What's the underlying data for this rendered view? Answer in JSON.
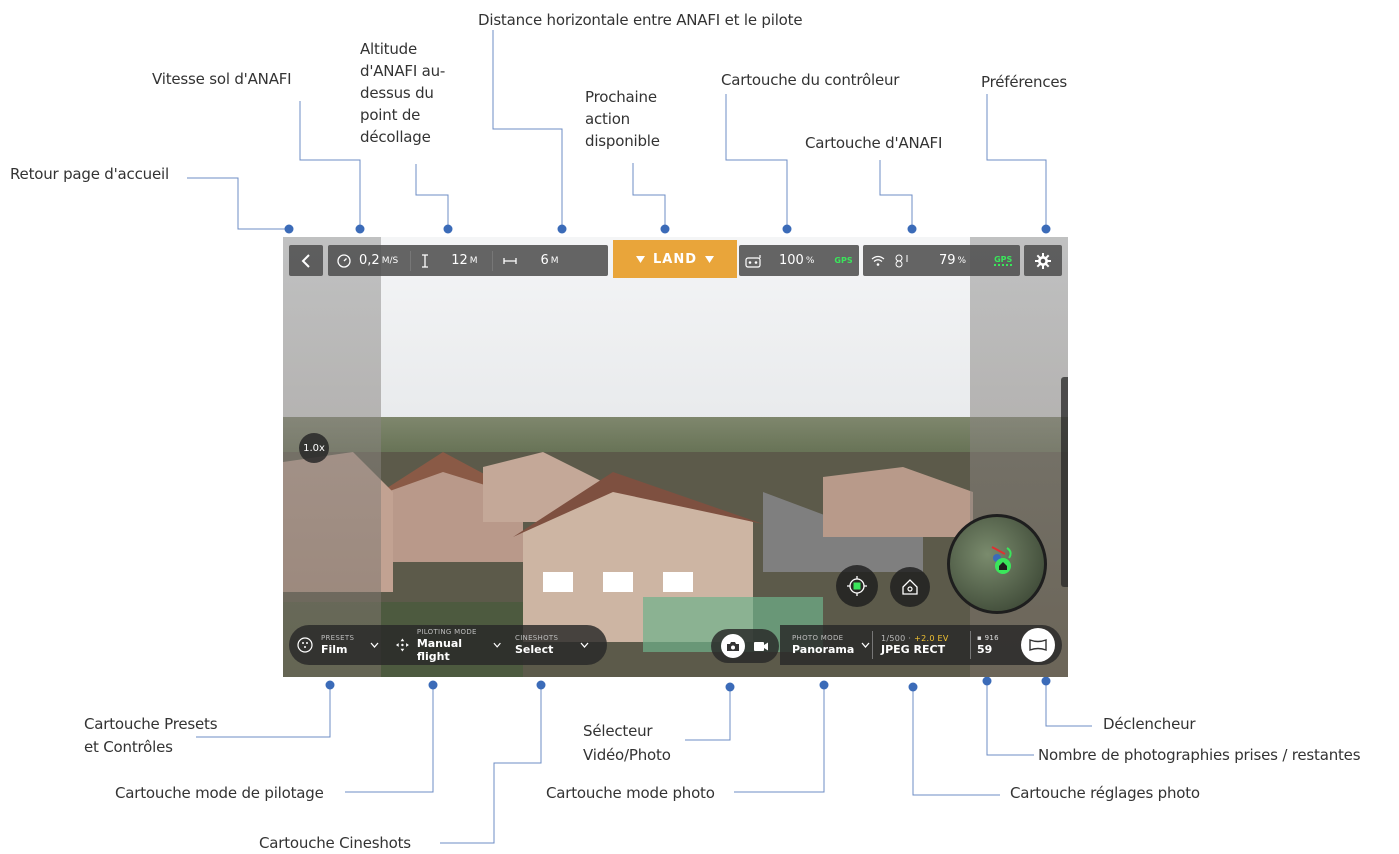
{
  "annotations": {
    "retour": "Retour page d'accueil",
    "vitesse": "Vitesse sol d'ANAFI",
    "altitude": "Altitude d'ANAFI au-dessus du point de décollage",
    "distance": "Distance horizontale entre ANAFI et le pilote",
    "prochaine": "Prochaine action disponible",
    "cartouche_controleur": "Cartouche du contrôleur",
    "cartouche_anafi": "Cartouche d'ANAFI",
    "preferences": "Préférences",
    "presets_line1": "Cartouche Presets",
    "presets_line2": "et Contrôles",
    "mode_pilotage": "Cartouche mode de pilotage",
    "cineshots": "Cartouche Cineshots",
    "selecteur_line1": "Sélecteur",
    "selecteur_line2": "Vidéo/Photo",
    "mode_photo": "Cartouche mode photo",
    "reglages_photo": "Cartouche réglages photo",
    "nombre_photos": "Nombre de photographies prises / restantes",
    "declencheur": "Déclencheur"
  },
  "hud": {
    "speed_value": "0,2",
    "speed_unit": "M/S",
    "altitude_value": "12",
    "altitude_unit": "M",
    "distance_value": "6",
    "distance_unit": "M",
    "land_label": "LAND",
    "controller_battery": "100",
    "controller_battery_unit": "%",
    "controller_gps": "GPS",
    "drone_battery": "79",
    "drone_battery_unit": "%",
    "drone_gps": "GPS",
    "zoom": "1.0x"
  },
  "bottom": {
    "presets_caption": "PRESETS",
    "presets_value": "Film",
    "piloting_caption": "PILOTING MODE",
    "piloting_value": "Manual flight",
    "cineshots_caption": "CINESHOTS",
    "cineshots_value": "Select",
    "photo_mode_caption": "PHOTO MODE",
    "photo_mode_value": "Panorama",
    "shutter_speed": "1/500",
    "separator": "·",
    "ev": "+2.0 EV",
    "format": "JPEG RECT",
    "photos_remaining": "916",
    "photos_taken": "59"
  },
  "colors": {
    "land_bg": "#e9a53a",
    "gps_green": "#3ae65b",
    "leader_line": "#4a6fb3",
    "dot": "#3b6bb8",
    "ev_yellow": "#f1c232"
  }
}
